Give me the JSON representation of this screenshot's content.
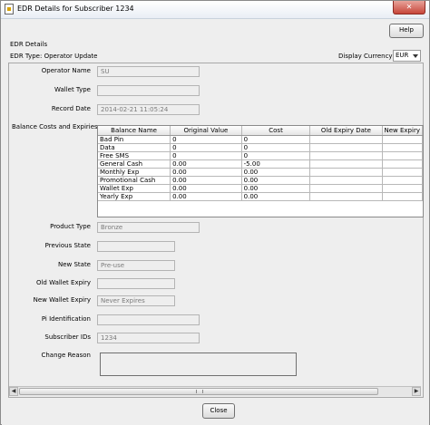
{
  "window": {
    "title": "EDR Details for Subscriber 1234",
    "close_glyph": "✕"
  },
  "toolbar": {
    "help_label": "Help"
  },
  "header": {
    "section_title": "EDR Details",
    "edr_type": "EDR Type: Operator Update",
    "currency_label": "Display Currency",
    "currency_value": "EUR"
  },
  "fields": {
    "operator_name": {
      "label": "Operator Name",
      "value": "SU"
    },
    "wallet_type": {
      "label": "Wallet Type",
      "value": ""
    },
    "record_date": {
      "label": "Record Date",
      "value": "2014-02-21 11:05:24"
    },
    "product_type": {
      "label": "Product Type",
      "value": "Bronze"
    },
    "previous_state": {
      "label": "Previous State",
      "value": ""
    },
    "new_state": {
      "label": "New State",
      "value": "Pre-use"
    },
    "old_wallet_expiry": {
      "label": "Old Wallet Expiry",
      "value": ""
    },
    "new_wallet_expiry": {
      "label": "New Wallet Expiry",
      "value": "Never Expires"
    },
    "pi_identification": {
      "label": "Pi Identification",
      "value": ""
    },
    "subscriber_ids": {
      "label": "Subscriber IDs",
      "value": "1234"
    },
    "change_reason": {
      "label": "Change Reason",
      "value": ""
    }
  },
  "balances": {
    "title": "Balance Costs and Expiries",
    "columns": [
      "Balance Name",
      "Original Value",
      "Cost",
      "Old Expiry Date",
      "New Expiry"
    ],
    "rows": [
      [
        "Bad Pin",
        "0",
        "0",
        "",
        ""
      ],
      [
        "Data",
        "0",
        "0",
        "",
        ""
      ],
      [
        "Free SMS",
        "0",
        "0",
        "",
        ""
      ],
      [
        "General Cash",
        "0.00",
        "-5.00",
        "",
        ""
      ],
      [
        "Monthly Exp",
        "0.00",
        "0.00",
        "",
        ""
      ],
      [
        "Promotional Cash",
        "0.00",
        "0.00",
        "",
        ""
      ],
      [
        "Wallet Exp",
        "0.00",
        "0.00",
        "",
        ""
      ],
      [
        "Yearly Exp",
        "0.00",
        "0.00",
        "",
        ""
      ]
    ]
  },
  "scrollbar": {
    "left_arrow": "◀",
    "right_arrow": "▶"
  },
  "footer": {
    "close_label": "Close"
  }
}
